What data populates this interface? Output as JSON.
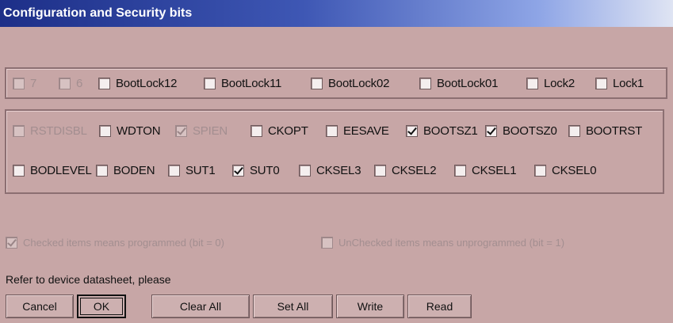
{
  "window": {
    "title": "Configuration and Security bits"
  },
  "lock_bits": [
    {
      "label": "7",
      "checked": false,
      "enabled": false
    },
    {
      "label": "6",
      "checked": false,
      "enabled": false
    },
    {
      "label": "BootLock12",
      "checked": false,
      "enabled": true
    },
    {
      "label": "BootLock11",
      "checked": false,
      "enabled": true
    },
    {
      "label": "BootLock02",
      "checked": false,
      "enabled": true
    },
    {
      "label": "BootLock01",
      "checked": false,
      "enabled": true
    },
    {
      "label": "Lock2",
      "checked": false,
      "enabled": true
    },
    {
      "label": "Lock1",
      "checked": false,
      "enabled": true
    }
  ],
  "fuse_high": [
    {
      "label": "RSTDISBL",
      "checked": false,
      "enabled": false
    },
    {
      "label": "WDTON",
      "checked": false,
      "enabled": true
    },
    {
      "label": "SPIEN",
      "checked": true,
      "enabled": false
    },
    {
      "label": "CKOPT",
      "checked": false,
      "enabled": true
    },
    {
      "label": "EESAVE",
      "checked": false,
      "enabled": true
    },
    {
      "label": "BOOTSZ1",
      "checked": true,
      "enabled": true
    },
    {
      "label": "BOOTSZ0",
      "checked": true,
      "enabled": true
    },
    {
      "label": "BOOTRST",
      "checked": false,
      "enabled": true
    }
  ],
  "fuse_low": [
    {
      "label": "BODLEVEL",
      "checked": false,
      "enabled": true
    },
    {
      "label": "BODEN",
      "checked": false,
      "enabled": true
    },
    {
      "label": "SUT1",
      "checked": false,
      "enabled": true
    },
    {
      "label": "SUT0",
      "checked": true,
      "enabled": true
    },
    {
      "label": "CKSEL3",
      "checked": false,
      "enabled": true
    },
    {
      "label": "CKSEL2",
      "checked": false,
      "enabled": true
    },
    {
      "label": "CKSEL1",
      "checked": false,
      "enabled": true
    },
    {
      "label": "CKSEL0",
      "checked": false,
      "enabled": true
    }
  ],
  "legend": {
    "checked_text": "Checked items means programmed (bit = 0)",
    "unchecked_text": "UnChecked items means unprogrammed (bit = 1)"
  },
  "hint": "Refer to device datasheet, please",
  "buttons": {
    "cancel": "Cancel",
    "ok": "OK",
    "clear_all": "Clear All",
    "set_all": "Set All",
    "write": "Write",
    "read": "Read"
  }
}
